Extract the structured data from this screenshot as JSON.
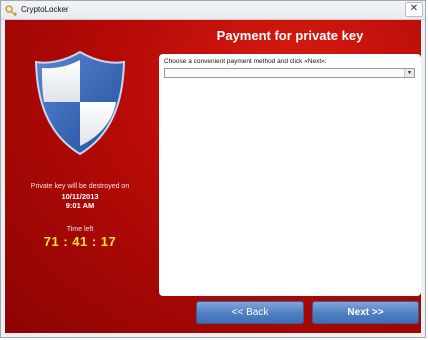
{
  "window": {
    "title": "CryptoLocker",
    "close_glyph": "✕",
    "app_icon": "key-icon"
  },
  "left_panel": {
    "shield_icon": "shield-icon",
    "destroy_label": "Private key will be destroyed on",
    "destroy_date": "10/11/2013",
    "destroy_time": "9:01 AM",
    "time_left_label": "Time left",
    "countdown": "71 : 41 : 17"
  },
  "main": {
    "heading": "Payment for private key",
    "instruction": "Choose a convenient payment method and click «Next»:",
    "payment_method": {
      "selected": ""
    }
  },
  "buttons": {
    "back_label": "<< Back",
    "next_label": "Next >>"
  },
  "colors": {
    "background_red": "#b50a06",
    "countdown_yellow": "#ffe62a",
    "button_blue": "#4f7fc2"
  }
}
